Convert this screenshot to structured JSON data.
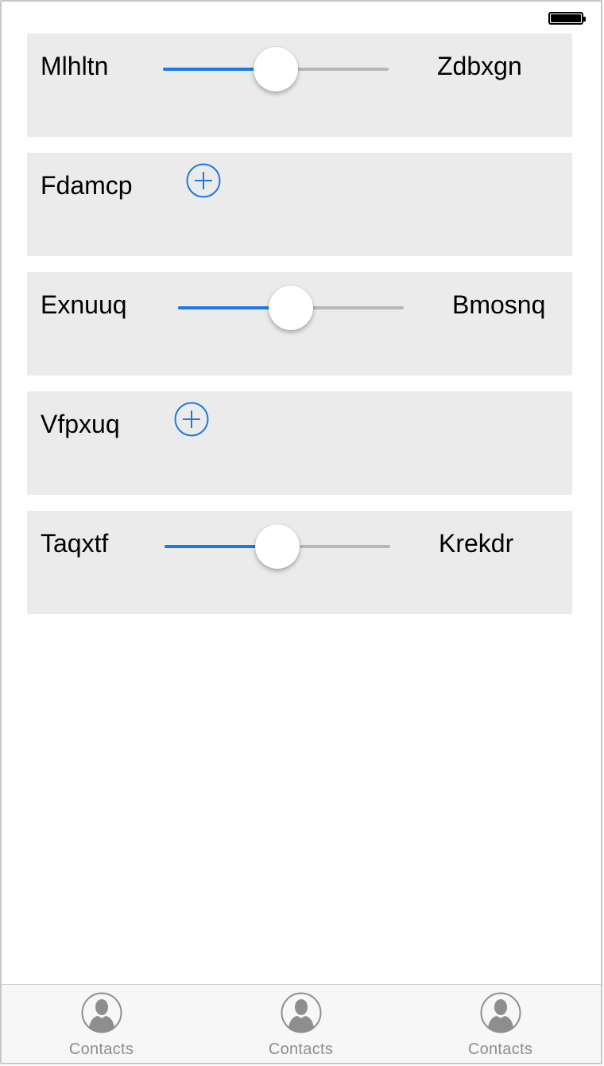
{
  "status_bar": {
    "battery_icon": "battery-full-icon",
    "battery_level": 1.0
  },
  "rows": [
    {
      "type": "slider",
      "left_label": "Mlhltn",
      "right_label": "Zdbxgn",
      "value": 0.5
    },
    {
      "type": "add",
      "label": "Fdamcp",
      "icon": "plus-circle-icon"
    },
    {
      "type": "slider",
      "left_label": "Exnuuq",
      "right_label": "Bmosnq",
      "value": 0.5
    },
    {
      "type": "add",
      "label": "Vfpxuq",
      "icon": "plus-circle-icon"
    },
    {
      "type": "slider",
      "left_label": "Taqxtf",
      "right_label": "Krekdr",
      "value": 0.5
    }
  ],
  "tab_bar": {
    "tabs": [
      {
        "label": "Contacts",
        "icon": "contact-person-icon"
      },
      {
        "label": "Contacts",
        "icon": "contact-person-icon"
      },
      {
        "label": "Contacts",
        "icon": "contact-person-icon"
      }
    ]
  },
  "colors": {
    "accent": "#1a7ae6",
    "card_background": "#ebebeb",
    "track_inactive": "#b7b7b7",
    "tab_label": "#8e8e8e",
    "tab_icon": "#8e8e8e"
  }
}
